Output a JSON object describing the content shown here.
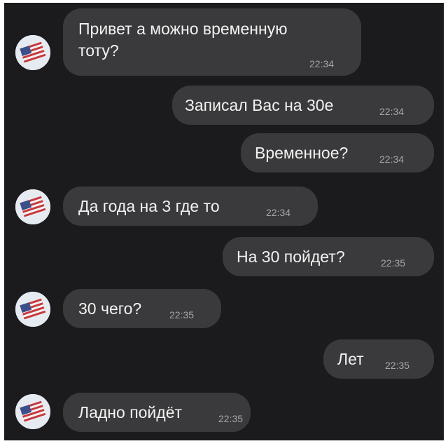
{
  "messages": [
    {
      "side": "left",
      "text_lines": [
        "Привет а можно временную",
        "тоту?"
      ],
      "time": "22:34"
    },
    {
      "side": "right",
      "text": "Записал Вас на 30е",
      "time": "22:34"
    },
    {
      "side": "right",
      "text": "Временное?",
      "time": "22:34"
    },
    {
      "side": "left",
      "text": "Да года на 3 где то",
      "time": "22:34"
    },
    {
      "side": "right",
      "text": "На 30 пойдет?",
      "time": "22:35"
    },
    {
      "side": "left",
      "text": "30 чего?",
      "time": "22:35"
    },
    {
      "side": "right",
      "text": "Лет",
      "time": "22:35"
    },
    {
      "side": "left",
      "text": "Ладно пойдёт",
      "time": "22:35"
    }
  ],
  "colors": {
    "background": "#1b1b1d",
    "bubble": "#3a3a3c",
    "text": "#f2f2f2",
    "timestamp": "#a6a6aa"
  },
  "icons": {
    "avatar": "us-flag-avatar-icon"
  }
}
